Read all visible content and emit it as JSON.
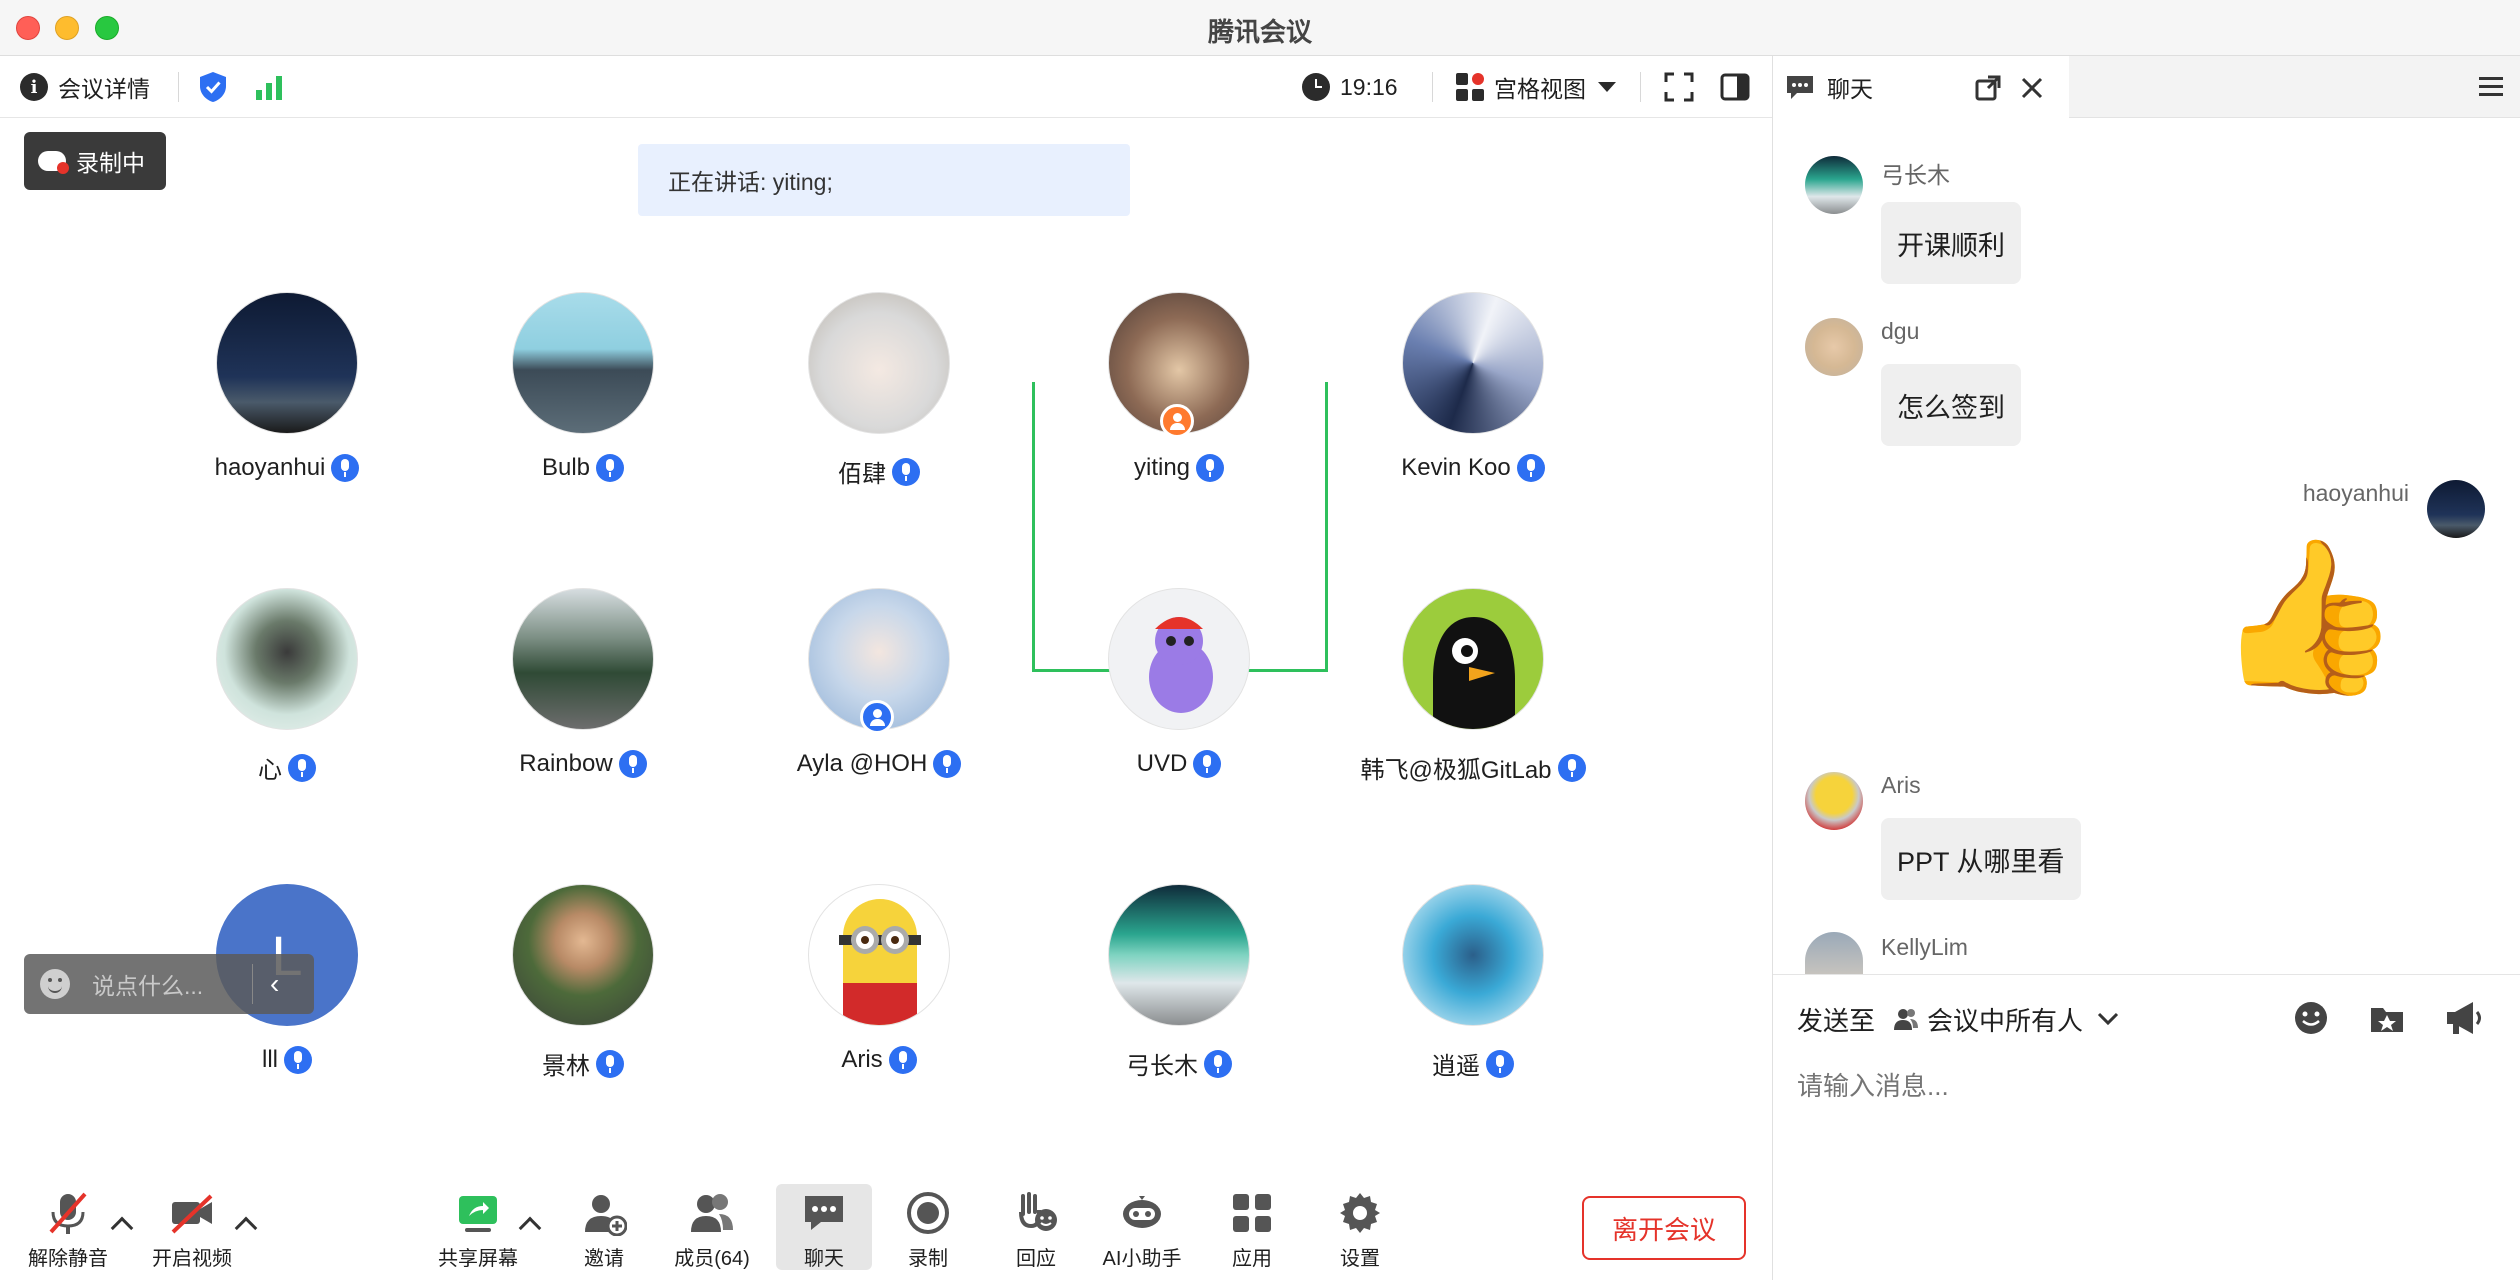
{
  "window": {
    "title": "腾讯会议"
  },
  "topbar": {
    "meeting_info": "会议详情",
    "time": "19:16",
    "view_mode": "宫格视图"
  },
  "stage": {
    "recording_badge": "录制中",
    "speaking_banner": "正在讲话: yiting;",
    "quick_chat_placeholder": "说点什么..."
  },
  "participants": [
    {
      "name": "haoyanhui"
    },
    {
      "name": "Bulb"
    },
    {
      "name": "佰肆"
    },
    {
      "name": "yiting"
    },
    {
      "name": "Kevin Koo"
    },
    {
      "name": "心"
    },
    {
      "name": "Rainbow"
    },
    {
      "name": "Ayla @HOH"
    },
    {
      "name": "UVD"
    },
    {
      "name": "韩飞@极狐GitLab"
    },
    {
      "name": "lll",
      "initial": "L"
    },
    {
      "name": "景林"
    },
    {
      "name": "Aris"
    },
    {
      "name": "弓长木"
    },
    {
      "name": "逍遥"
    }
  ],
  "toolbar": {
    "unmute": "解除静音",
    "start_video": "开启视频",
    "share_screen": "共享屏幕",
    "invite": "邀请",
    "members": "成员(64)",
    "chat": "聊天",
    "record": "录制",
    "react": "回应",
    "ai_assistant": "AI小助手",
    "apps": "应用",
    "settings": "设置",
    "leave": "离开会议"
  },
  "chat": {
    "tab_label": "聊天",
    "messages": [
      {
        "sender": "弓长木",
        "text": "开课顺利"
      },
      {
        "sender": "dgu",
        "text": "怎么签到"
      },
      {
        "sender": "haoyanhui",
        "text": "👍"
      },
      {
        "sender": "Aris",
        "text": "PPT 从哪里看"
      },
      {
        "sender": "KellyLim",
        "text": ""
      }
    ],
    "send_to_label": "发送至",
    "send_to_target": "会议中所有人",
    "input_placeholder": "请输入消息..."
  }
}
